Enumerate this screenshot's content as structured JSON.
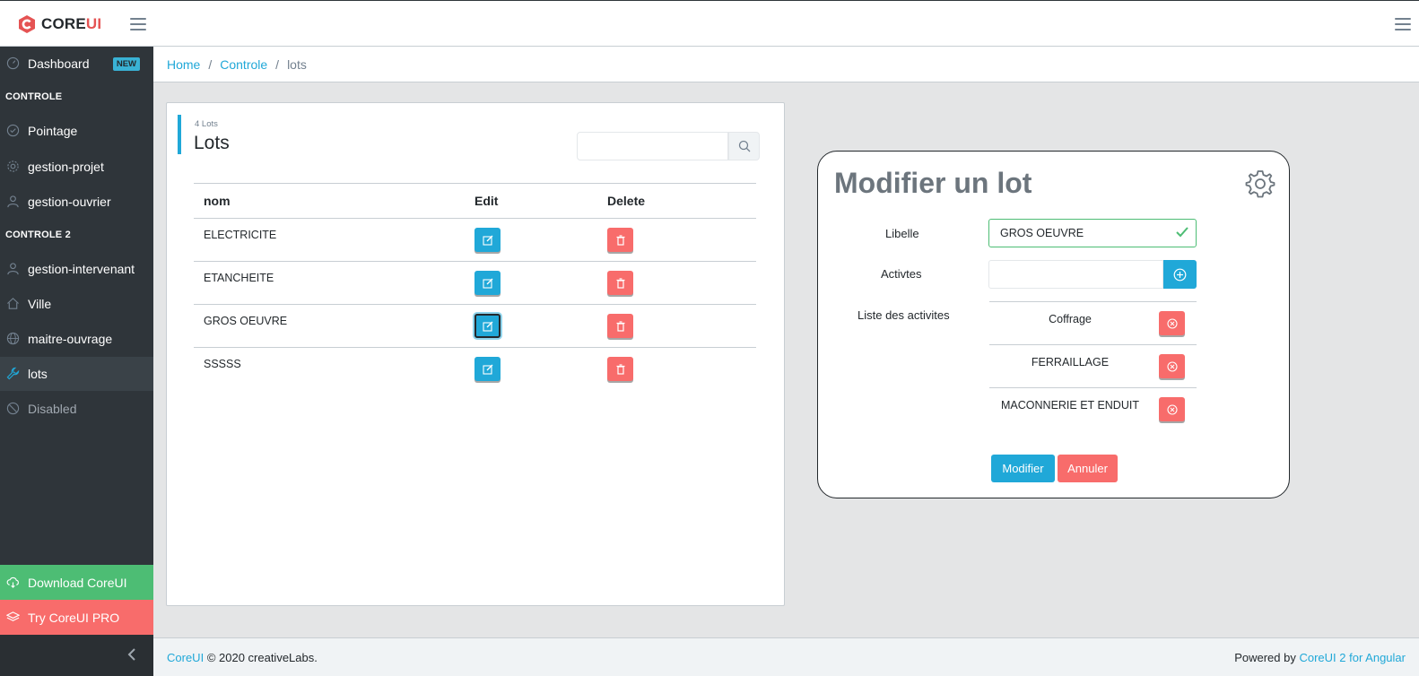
{
  "brand": {
    "word_main": "CORE",
    "word_accent": "UI"
  },
  "breadcrumb": {
    "home": "Home",
    "controle": "Controle",
    "current": "lots"
  },
  "sidebar": {
    "dashboard": "Dashboard",
    "badge": "NEW",
    "title1": "CONTROLE",
    "pointage": "Pointage",
    "gestion_projet": "gestion-projet",
    "gestion_ouvrier": "gestion-ouvrier",
    "title2": "CONTROLE 2",
    "gestion_intervenant": "gestion-intervenant",
    "ville": "Ville",
    "maitre_ouvrage": "maitre-ouvrage",
    "lots": "lots",
    "disabled": "Disabled",
    "download": "Download CoreUI",
    "pro": "Try CoreUI PRO"
  },
  "lots": {
    "count": "4 Lots",
    "title": "Lots",
    "columns": [
      "nom",
      "Edit",
      "Delete"
    ],
    "rows": [
      "ELECTRICITE",
      "ETANCHEITE",
      "GROS OEUVRE",
      "SSSSS"
    ]
  },
  "modifier": {
    "title": "Modifier un lot",
    "label_libelle": "Libelle",
    "libelle_value": "GROS OEUVRE",
    "label_activites": "Activtes",
    "label_liste": "Liste des activites",
    "activites": [
      "Coffrage",
      "FERRAILLAGE",
      "MACONNERIE ET ENDUIT"
    ],
    "btn_modifier": "Modifier",
    "btn_annuler": "Annuler"
  },
  "footer": {
    "brand_link": "CoreUI",
    "copyright": "© 2020 creativeLabs.",
    "powered": "Powered by",
    "powered_link": "CoreUI 2 for Angular"
  },
  "colors": {
    "primary": "#20a8d8",
    "danger": "#f86c6b",
    "success": "#4dbd74",
    "sidebar": "#2f353a"
  }
}
